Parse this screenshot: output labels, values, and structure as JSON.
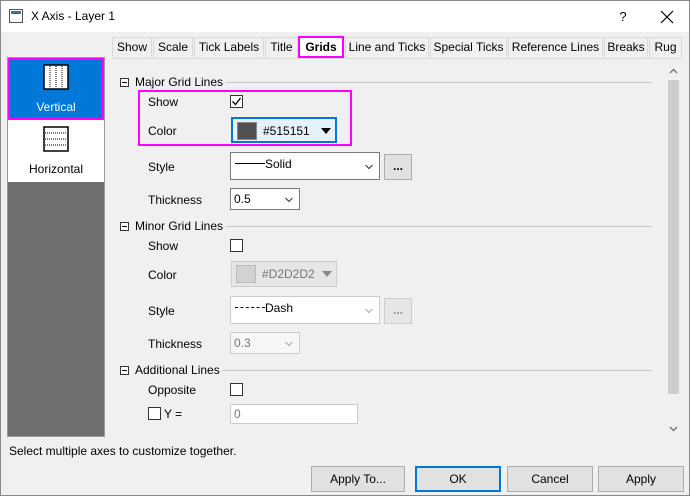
{
  "window": {
    "title": "X Axis - Layer 1",
    "help_glyph": "?"
  },
  "sidebar": {
    "items": [
      {
        "label": "Vertical",
        "selected": true
      },
      {
        "label": "Horizontal",
        "selected": false
      }
    ]
  },
  "tabs": [
    {
      "label": "Show"
    },
    {
      "label": "Scale"
    },
    {
      "label": "Tick Labels"
    },
    {
      "label": "Title"
    },
    {
      "label": "Grids",
      "active": true
    },
    {
      "label": "Line and Ticks"
    },
    {
      "label": "Special Ticks"
    },
    {
      "label": "Reference Lines"
    },
    {
      "label": "Breaks"
    },
    {
      "label": "Rug"
    }
  ],
  "major": {
    "header": "Major Grid Lines",
    "show_label": "Show",
    "show_checked": true,
    "color_label": "Color",
    "color_value": "#515151",
    "style_label": "Style",
    "style_value": "Solid",
    "ellipsis": "...",
    "thickness_label": "Thickness",
    "thickness_value": "0.5"
  },
  "minor": {
    "header": "Minor Grid Lines",
    "show_label": "Show",
    "show_checked": false,
    "color_label": "Color",
    "color_value": "#D2D2D2",
    "style_label": "Style",
    "style_value": "Dash",
    "ellipsis": "...",
    "thickness_label": "Thickness",
    "thickness_value": "0.3"
  },
  "additional": {
    "header": "Additional Lines",
    "opposite_label": "Opposite",
    "opposite_checked": false,
    "y_label": "Y =",
    "y_checked": false,
    "y_value": "0"
  },
  "status_text": "Select multiple axes to customize together.",
  "buttons": {
    "apply_to": "Apply To...",
    "ok": "OK",
    "cancel": "Cancel",
    "apply": "Apply"
  },
  "colors": {
    "accent": "#0078d7",
    "highlight": "#ff00ff",
    "major_swatch": "#515151",
    "minor_swatch": "#D2D2D2"
  }
}
